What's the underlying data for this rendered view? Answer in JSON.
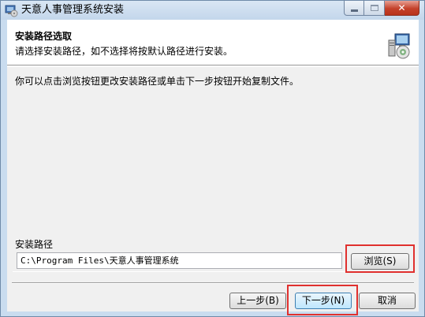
{
  "window": {
    "title": "天意人事管理系统安装",
    "close_glyph": "✕"
  },
  "header": {
    "title": "安装路径选取",
    "subtitle": "请选择安装路径，如不选择将按默认路径进行安装。"
  },
  "body": {
    "instruction": "你可以点击浏览按钮更改安装路径或单击下一步按钮开始复制文件。"
  },
  "install_path": {
    "label": "安装路径",
    "value": "C:\\Program Files\\天意人事管理系统",
    "browse_label": "浏览(S)"
  },
  "footer": {
    "back_label": "上一步(B)",
    "next_label": "下一步(N)",
    "cancel_label": "取消"
  },
  "colors": {
    "highlight": "#e0302e",
    "title_bar": "#c9dcef",
    "close_button": "#c4412a"
  },
  "icons": {
    "app": "installer-app-icon",
    "header": "setup-computer-disc-icon"
  }
}
